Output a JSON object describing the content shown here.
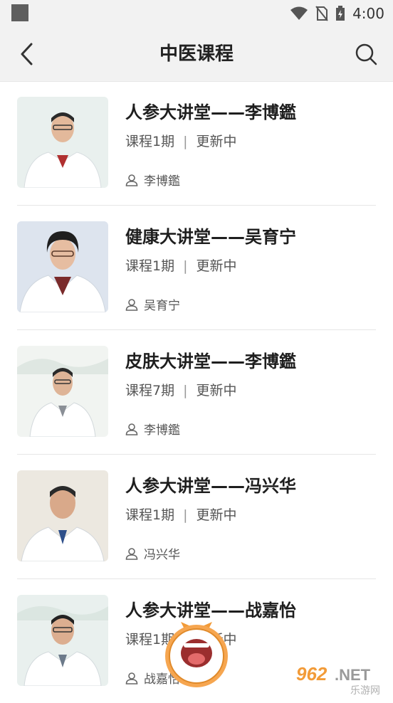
{
  "status": {
    "time": "4:00"
  },
  "app": {
    "title": "中医课程"
  },
  "items": [
    {
      "title": "人参大讲堂——李博鑑",
      "count": "课程1期",
      "state": "更新中",
      "author": "李博鑑"
    },
    {
      "title": "健康大讲堂——吴育宁",
      "count": "课程1期",
      "state": "更新中",
      "author": "吴育宁"
    },
    {
      "title": "皮肤大讲堂——李博鑑",
      "count": "课程7期",
      "state": "更新中",
      "author": "李博鑑"
    },
    {
      "title": "人参大讲堂——冯兴华",
      "count": "课程1期",
      "state": "更新中",
      "author": "冯兴华"
    },
    {
      "title": "人参大讲堂——战嘉怡",
      "count": "课程1期",
      "state": "更新中",
      "author": "战嘉怡"
    }
  ],
  "watermark": {
    "text": "962.NET",
    "subtext": "乐游网"
  },
  "colors": {
    "accent": "#f29b38",
    "header_bg": "#f2f2f2",
    "divider": "#e6e6e6"
  }
}
